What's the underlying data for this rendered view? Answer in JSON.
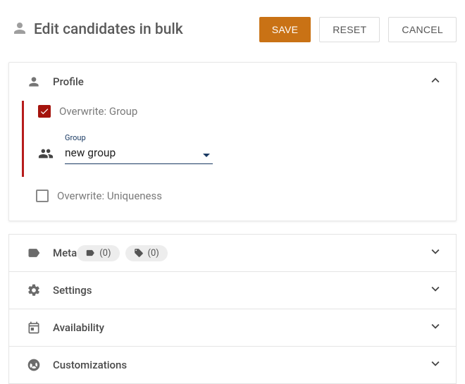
{
  "header": {
    "title": "Edit candidates in bulk",
    "save_label": "SAVE",
    "reset_label": "RESET",
    "cancel_label": "CANCEL"
  },
  "profile": {
    "title": "Profile",
    "overwrite_group_label": "Overwrite: Group",
    "overwrite_group_checked": true,
    "group_field_label": "Group",
    "group_field_value": "new group",
    "overwrite_uniqueness_label": "Overwrite: Uniqueness",
    "overwrite_uniqueness_checked": false
  },
  "panels": {
    "meta": {
      "label": "Meta",
      "chip1_count": "(0)",
      "chip2_count": "(0)"
    },
    "settings": {
      "label": "Settings"
    },
    "availability": {
      "label": "Availability"
    },
    "customizations": {
      "label": "Customizations"
    }
  }
}
